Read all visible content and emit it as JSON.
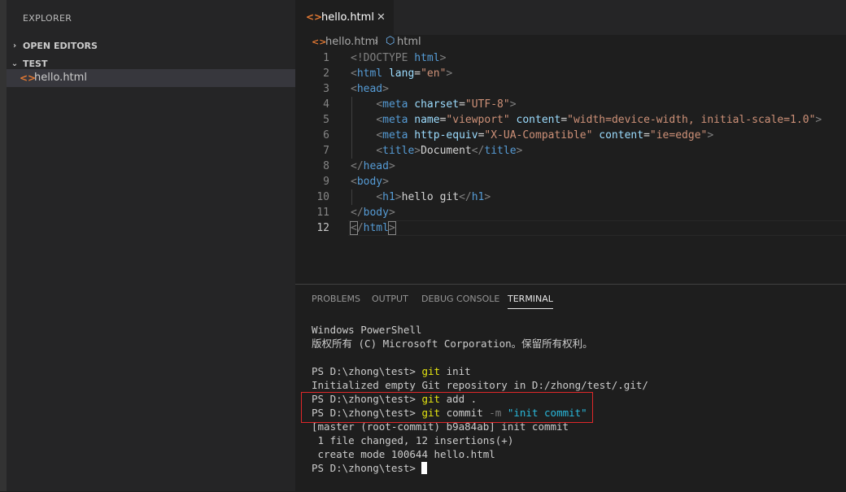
{
  "explorer": {
    "title": "EXPLORER",
    "open_editors": "OPEN EDITORS",
    "folder": "TEST",
    "file": "hello.html"
  },
  "tab": {
    "label": "hello.html",
    "close": "✕"
  },
  "breadcrumb": {
    "file": "hello.html",
    "element": "html"
  },
  "code_lines": [
    [
      {
        "c": "tg",
        "t": "<!DOCTYPE "
      },
      {
        "c": "tn",
        "t": "html"
      },
      {
        "c": "tg",
        "t": ">"
      }
    ],
    [
      {
        "c": "tg",
        "t": "<"
      },
      {
        "c": "tn",
        "t": "html"
      },
      {
        "c": "tx",
        "t": " "
      },
      {
        "c": "an",
        "t": "lang"
      },
      {
        "c": "tx",
        "t": "="
      },
      {
        "c": "av",
        "t": "\"en\""
      },
      {
        "c": "tg",
        "t": ">"
      }
    ],
    [
      {
        "c": "tg",
        "t": "<"
      },
      {
        "c": "tn",
        "t": "head"
      },
      {
        "c": "tg",
        "t": ">"
      }
    ],
    [
      {
        "c": "tx",
        "t": "    "
      },
      {
        "c": "tg",
        "t": "<"
      },
      {
        "c": "tn",
        "t": "meta"
      },
      {
        "c": "tx",
        "t": " "
      },
      {
        "c": "an",
        "t": "charset"
      },
      {
        "c": "tx",
        "t": "="
      },
      {
        "c": "av",
        "t": "\"UTF-8\""
      },
      {
        "c": "tg",
        "t": ">"
      }
    ],
    [
      {
        "c": "tx",
        "t": "    "
      },
      {
        "c": "tg",
        "t": "<"
      },
      {
        "c": "tn",
        "t": "meta"
      },
      {
        "c": "tx",
        "t": " "
      },
      {
        "c": "an",
        "t": "name"
      },
      {
        "c": "tx",
        "t": "="
      },
      {
        "c": "av",
        "t": "\"viewport\""
      },
      {
        "c": "tx",
        "t": " "
      },
      {
        "c": "an",
        "t": "content"
      },
      {
        "c": "tx",
        "t": "="
      },
      {
        "c": "av",
        "t": "\"width=device-width, initial-scale=1.0\""
      },
      {
        "c": "tg",
        "t": ">"
      }
    ],
    [
      {
        "c": "tx",
        "t": "    "
      },
      {
        "c": "tg",
        "t": "<"
      },
      {
        "c": "tn",
        "t": "meta"
      },
      {
        "c": "tx",
        "t": " "
      },
      {
        "c": "an",
        "t": "http-equiv"
      },
      {
        "c": "tx",
        "t": "="
      },
      {
        "c": "av",
        "t": "\"X-UA-Compatible\""
      },
      {
        "c": "tx",
        "t": " "
      },
      {
        "c": "an",
        "t": "content"
      },
      {
        "c": "tx",
        "t": "="
      },
      {
        "c": "av",
        "t": "\"ie=edge\""
      },
      {
        "c": "tg",
        "t": ">"
      }
    ],
    [
      {
        "c": "tx",
        "t": "    "
      },
      {
        "c": "tg",
        "t": "<"
      },
      {
        "c": "tn",
        "t": "title"
      },
      {
        "c": "tg",
        "t": ">"
      },
      {
        "c": "tx",
        "t": "Document"
      },
      {
        "c": "tg",
        "t": "</"
      },
      {
        "c": "tn",
        "t": "title"
      },
      {
        "c": "tg",
        "t": ">"
      }
    ],
    [
      {
        "c": "tg",
        "t": "</"
      },
      {
        "c": "tn",
        "t": "head"
      },
      {
        "c": "tg",
        "t": ">"
      }
    ],
    [
      {
        "c": "tg",
        "t": "<"
      },
      {
        "c": "tn",
        "t": "body"
      },
      {
        "c": "tg",
        "t": ">"
      }
    ],
    [
      {
        "c": "tx",
        "t": "    "
      },
      {
        "c": "tg",
        "t": "<"
      },
      {
        "c": "tn",
        "t": "h1"
      },
      {
        "c": "tg",
        "t": ">"
      },
      {
        "c": "tx",
        "t": "hello git"
      },
      {
        "c": "tg",
        "t": "</"
      },
      {
        "c": "tn",
        "t": "h1"
      },
      {
        "c": "tg",
        "t": ">"
      }
    ],
    [
      {
        "c": "tg",
        "t": "</"
      },
      {
        "c": "tn",
        "t": "body"
      },
      {
        "c": "tg",
        "t": ">"
      }
    ],
    [
      {
        "c": "tg bm",
        "t": "<"
      },
      {
        "c": "tg",
        "t": "/"
      },
      {
        "c": "tn",
        "t": "html"
      },
      {
        "c": "tg bm",
        "t": ">"
      }
    ]
  ],
  "current_line": 12,
  "panel": {
    "tabs": [
      "PROBLEMS",
      "OUTPUT",
      "DEBUG CONSOLE",
      "TERMINAL"
    ],
    "active_tab": "TERMINAL"
  },
  "terminal_lines": [
    [
      {
        "c": "",
        "t": "Windows PowerShell"
      }
    ],
    [
      {
        "c": "",
        "t": "版权所有 (C) Microsoft Corporation。保留所有权利。"
      }
    ],
    [
      {
        "c": "",
        "t": ""
      }
    ],
    [
      {
        "c": "",
        "t": "PS D:\\zhong\\test> "
      },
      {
        "c": "ty",
        "t": "git"
      },
      {
        "c": "",
        "t": " init"
      }
    ],
    [
      {
        "c": "",
        "t": "Initialized empty Git repository in D:/zhong/test/.git/"
      }
    ],
    [
      {
        "c": "",
        "t": "PS D:\\zhong\\test> "
      },
      {
        "c": "ty",
        "t": "git"
      },
      {
        "c": "",
        "t": " add ."
      }
    ],
    [
      {
        "c": "",
        "t": "PS D:\\zhong\\test> "
      },
      {
        "c": "ty",
        "t": "git"
      },
      {
        "c": "",
        "t": " commit "
      },
      {
        "c": "tgray",
        "t": "-m"
      },
      {
        "c": "",
        "t": " "
      },
      {
        "c": "tc",
        "t": "\"init commit\""
      }
    ],
    [
      {
        "c": "",
        "t": "[master (root-commit) b9a84ab] init commit"
      }
    ],
    [
      {
        "c": "",
        "t": " 1 file changed, 12 insertions(+)"
      }
    ],
    [
      {
        "c": "",
        "t": " create mode 100644 hello.html"
      }
    ],
    [
      {
        "c": "",
        "t": "PS D:\\zhong\\test> "
      }
    ]
  ]
}
